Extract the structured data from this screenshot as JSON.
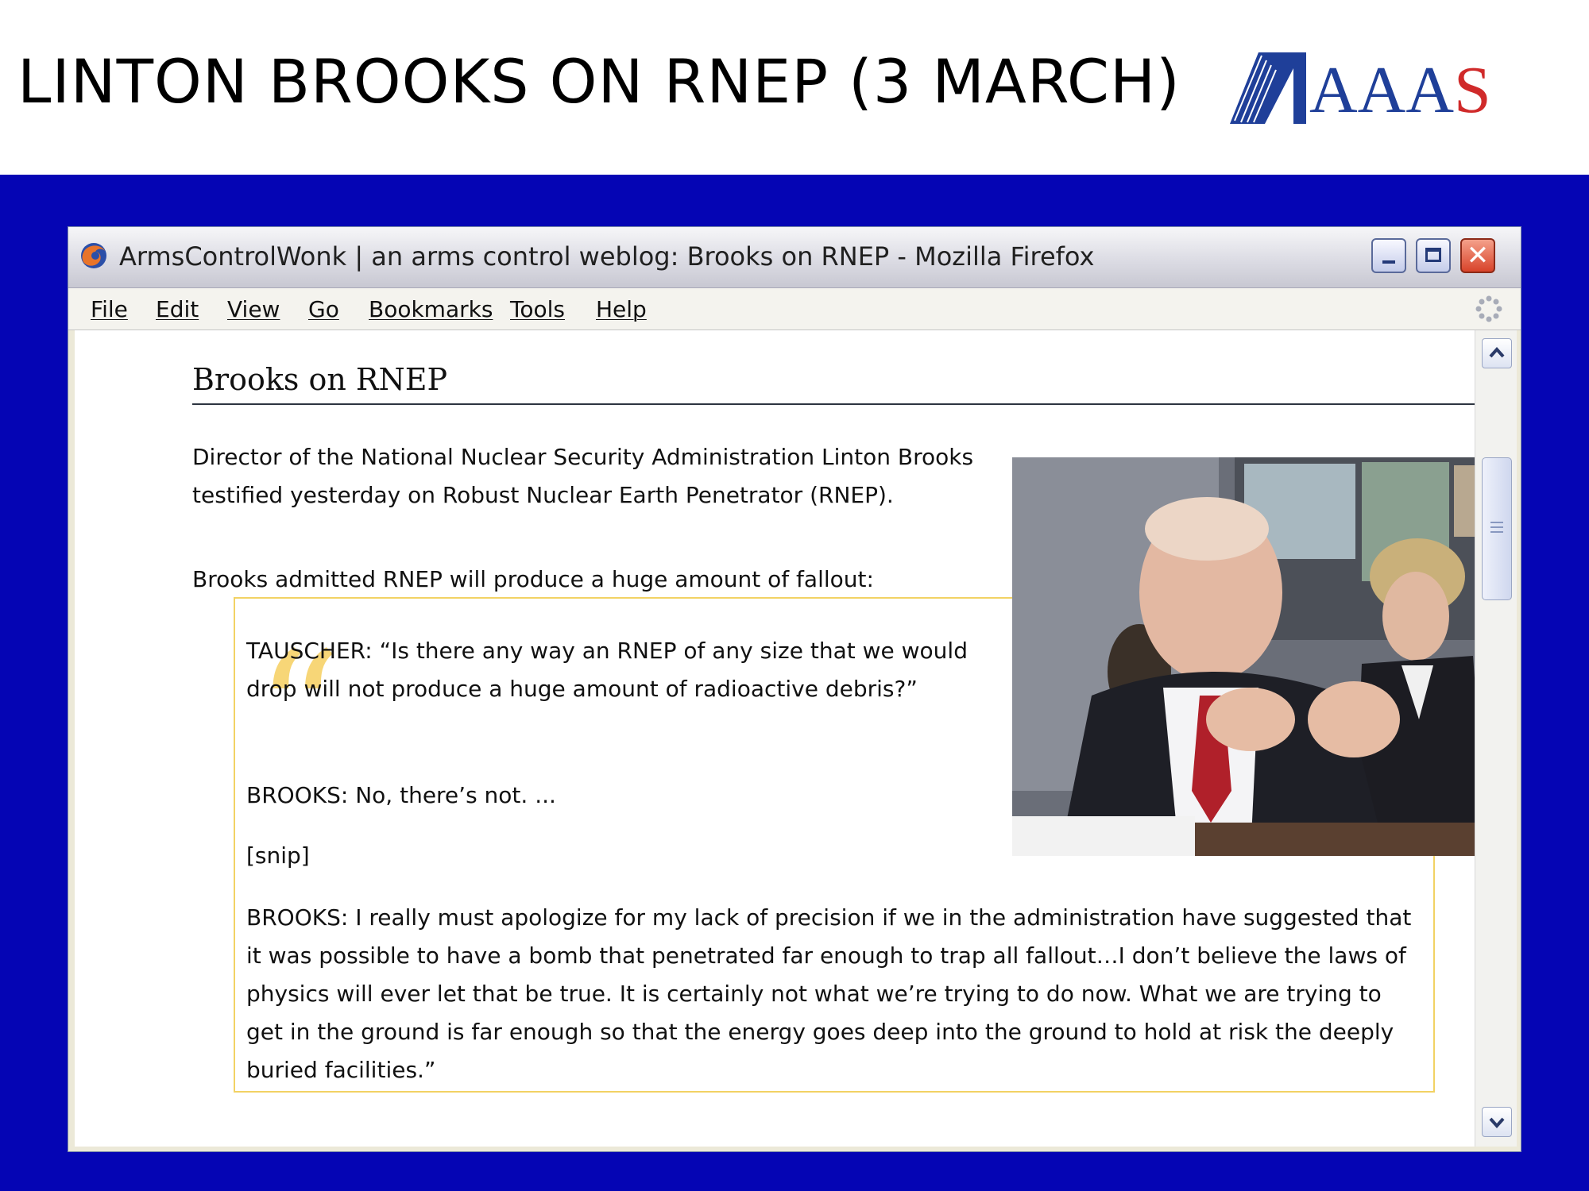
{
  "slide": {
    "title": "LINTON BROOKS ON RNEP (3 MARCH)",
    "logo_text": "AAAS"
  },
  "colors": {
    "slide_background": "#0505b4",
    "logo_blue": "#1f3f99",
    "logo_red": "#d02a2a",
    "quote_border": "#f2d264"
  },
  "browser": {
    "window_title": "ArmsControlWonk | an arms control weblog: Brooks on RNEP - Mozilla Firefox",
    "app_icon": "firefox-icon",
    "window_buttons": [
      "minimize",
      "maximize",
      "close"
    ],
    "menu": [
      {
        "label": "File"
      },
      {
        "label": "Edit"
      },
      {
        "label": "View"
      },
      {
        "label": "Go"
      },
      {
        "label": "Bookmarks"
      },
      {
        "label": "Tools"
      },
      {
        "label": "Help"
      }
    ]
  },
  "post": {
    "title": "Brooks on RNEP",
    "intro": "Director of the National Nuclear Security Administration Linton Brooks testified yesterday on Robust Nuclear Earth Penetrator (RNEP).",
    "lead": "Brooks admitted RNEP will produce a huge amount of fallout:",
    "photo_icon": "photo-of-linton-brooks",
    "quote": {
      "tauscher": "TAUSCHER: “Is there any way an RNEP of any size that we would drop will not produce a huge amount of radioactive debris?”",
      "brooks_1": "BROOKS: No, there’s not. ...",
      "snip": "[snip]",
      "brooks_2": "BROOKS: I really must apologize for my lack of precision if we in the administration have suggested that it was possible to have a bomb that penetrated far enough to trap all fallout…I don’t believe the laws of physics will ever let that be true. It is certainly not what we’re trying to do now. What we are trying to get in the ground is far enough so that the energy goes deep into the ground to hold at risk the deeply buried facilities.”"
    }
  }
}
